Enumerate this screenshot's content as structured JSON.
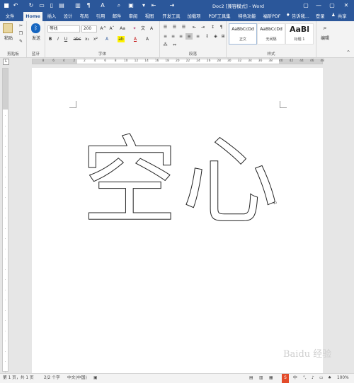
{
  "app": {
    "title": "Doc2 [兼容模式] - Word",
    "window_controls": [
      "▢",
      "—",
      "▢",
      "✕"
    ]
  },
  "qat": {
    "icons": [
      "save-icon",
      "undo-icon",
      "redo-icon",
      "folder-icon",
      "new-doc-icon",
      "preview-icon",
      "layout-icon",
      "paragraph-icon",
      "font-color-icon",
      "search-icon",
      "save-as-icon",
      "customize-icon",
      "indent-icon",
      "more-icon"
    ]
  },
  "tabs": {
    "items": [
      "文件",
      "Home",
      "插入",
      "设计",
      "布局",
      "引用",
      "邮件",
      "审阅",
      "视图",
      "开发工具",
      "加载项",
      "PDF工具集",
      "特色功能",
      "福昕PDF"
    ],
    "tell_me": "告诉我...",
    "login": "登录",
    "share": "共享"
  },
  "ribbon": {
    "clipboard": {
      "paste": "粘贴",
      "label": "剪贴板"
    },
    "bluetooth": {
      "send": "发送",
      "label": "蓝牙"
    },
    "font": {
      "name": "等线",
      "size": "200",
      "grow": "A^",
      "shrink": "Aˇ",
      "case": "Aa",
      "bold": "B",
      "italic": "I",
      "underline": "U",
      "strike": "abc",
      "sub": "x₂",
      "sup": "x²",
      "label": "字体"
    },
    "paragraph": {
      "label": "段落"
    },
    "styles": {
      "items": [
        {
          "preview": "AaBbCcDd",
          "name": "正文"
        },
        {
          "preview": "AaBbCcDd",
          "name": "无间隔"
        },
        {
          "preview": "AaBl",
          "name": "标题 1"
        }
      ],
      "label": "样式"
    },
    "editing": {
      "label": "编辑"
    }
  },
  "ruler": {
    "marks": [
      "8",
      "6",
      "4",
      "2",
      "2",
      "4",
      "6",
      "8",
      "10",
      "12",
      "14",
      "16",
      "18",
      "20",
      "22",
      "24",
      "26",
      "28",
      "30",
      "32",
      "34",
      "36",
      "38",
      "40",
      "42",
      "44",
      "46",
      "48"
    ]
  },
  "document": {
    "text": "空心"
  },
  "status": {
    "page": "第 1 页，共 1 页",
    "words": "2/2 个字",
    "lang": "中文(中国)",
    "zoom": "100%"
  },
  "watermark": "Baidu 经验"
}
